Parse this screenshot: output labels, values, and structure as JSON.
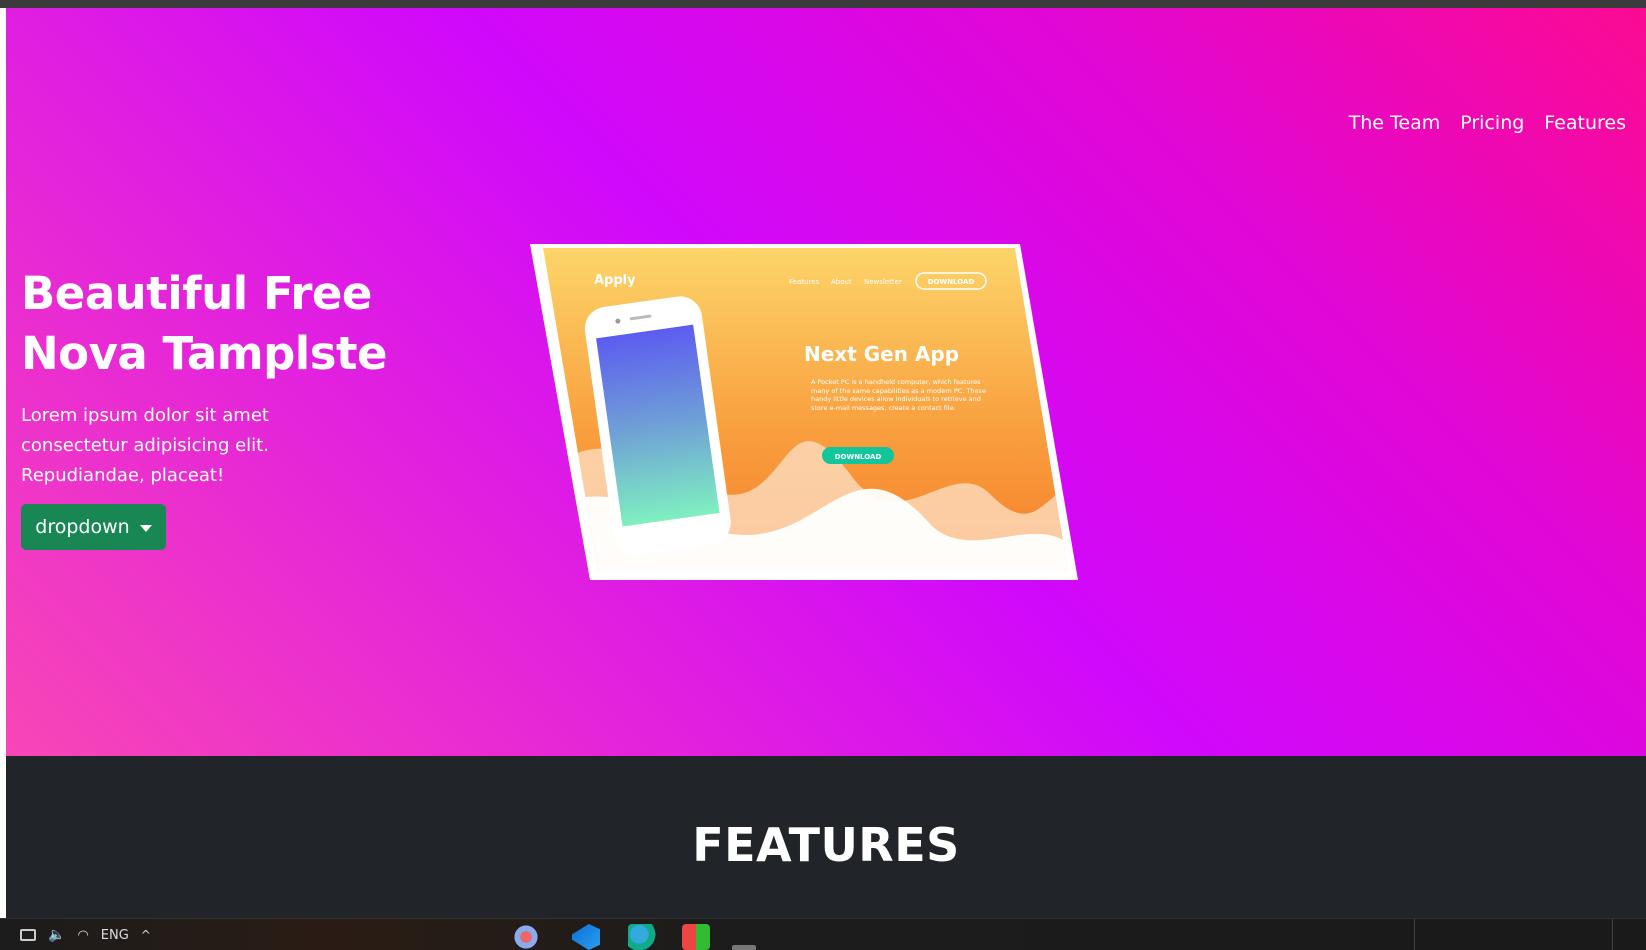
{
  "nav": {
    "items": [
      "The Team",
      "Pricing",
      "Features"
    ]
  },
  "hero": {
    "title": "Beautiful Free Nova Tamplste",
    "text": "Lorem ipsum dolor sit amet consectetur adipisicing elit. Repudiandae, placeat!",
    "dropdown_label": "dropdown"
  },
  "mockup": {
    "logo": "Apply",
    "nav": [
      "Features",
      "About",
      "Newsletter"
    ],
    "download_outline": "DOWNLOAD",
    "heading": "Next Gen App",
    "body": "A Pocket PC is a handheld computer, which features many of the same capabilities as a modern PC. These handy little devices allow individuals to retrieve and store e-mail messages, create a contact file.",
    "download_button": "DOWNLOAD"
  },
  "features": {
    "title": "FEATURES"
  },
  "taskbar": {
    "language": "ENG"
  },
  "colors": {
    "hero_gradient": [
      "#f846b6",
      "#d008fb",
      "#fb0a92"
    ],
    "button_green": "#198754",
    "features_bg": "#212529"
  }
}
